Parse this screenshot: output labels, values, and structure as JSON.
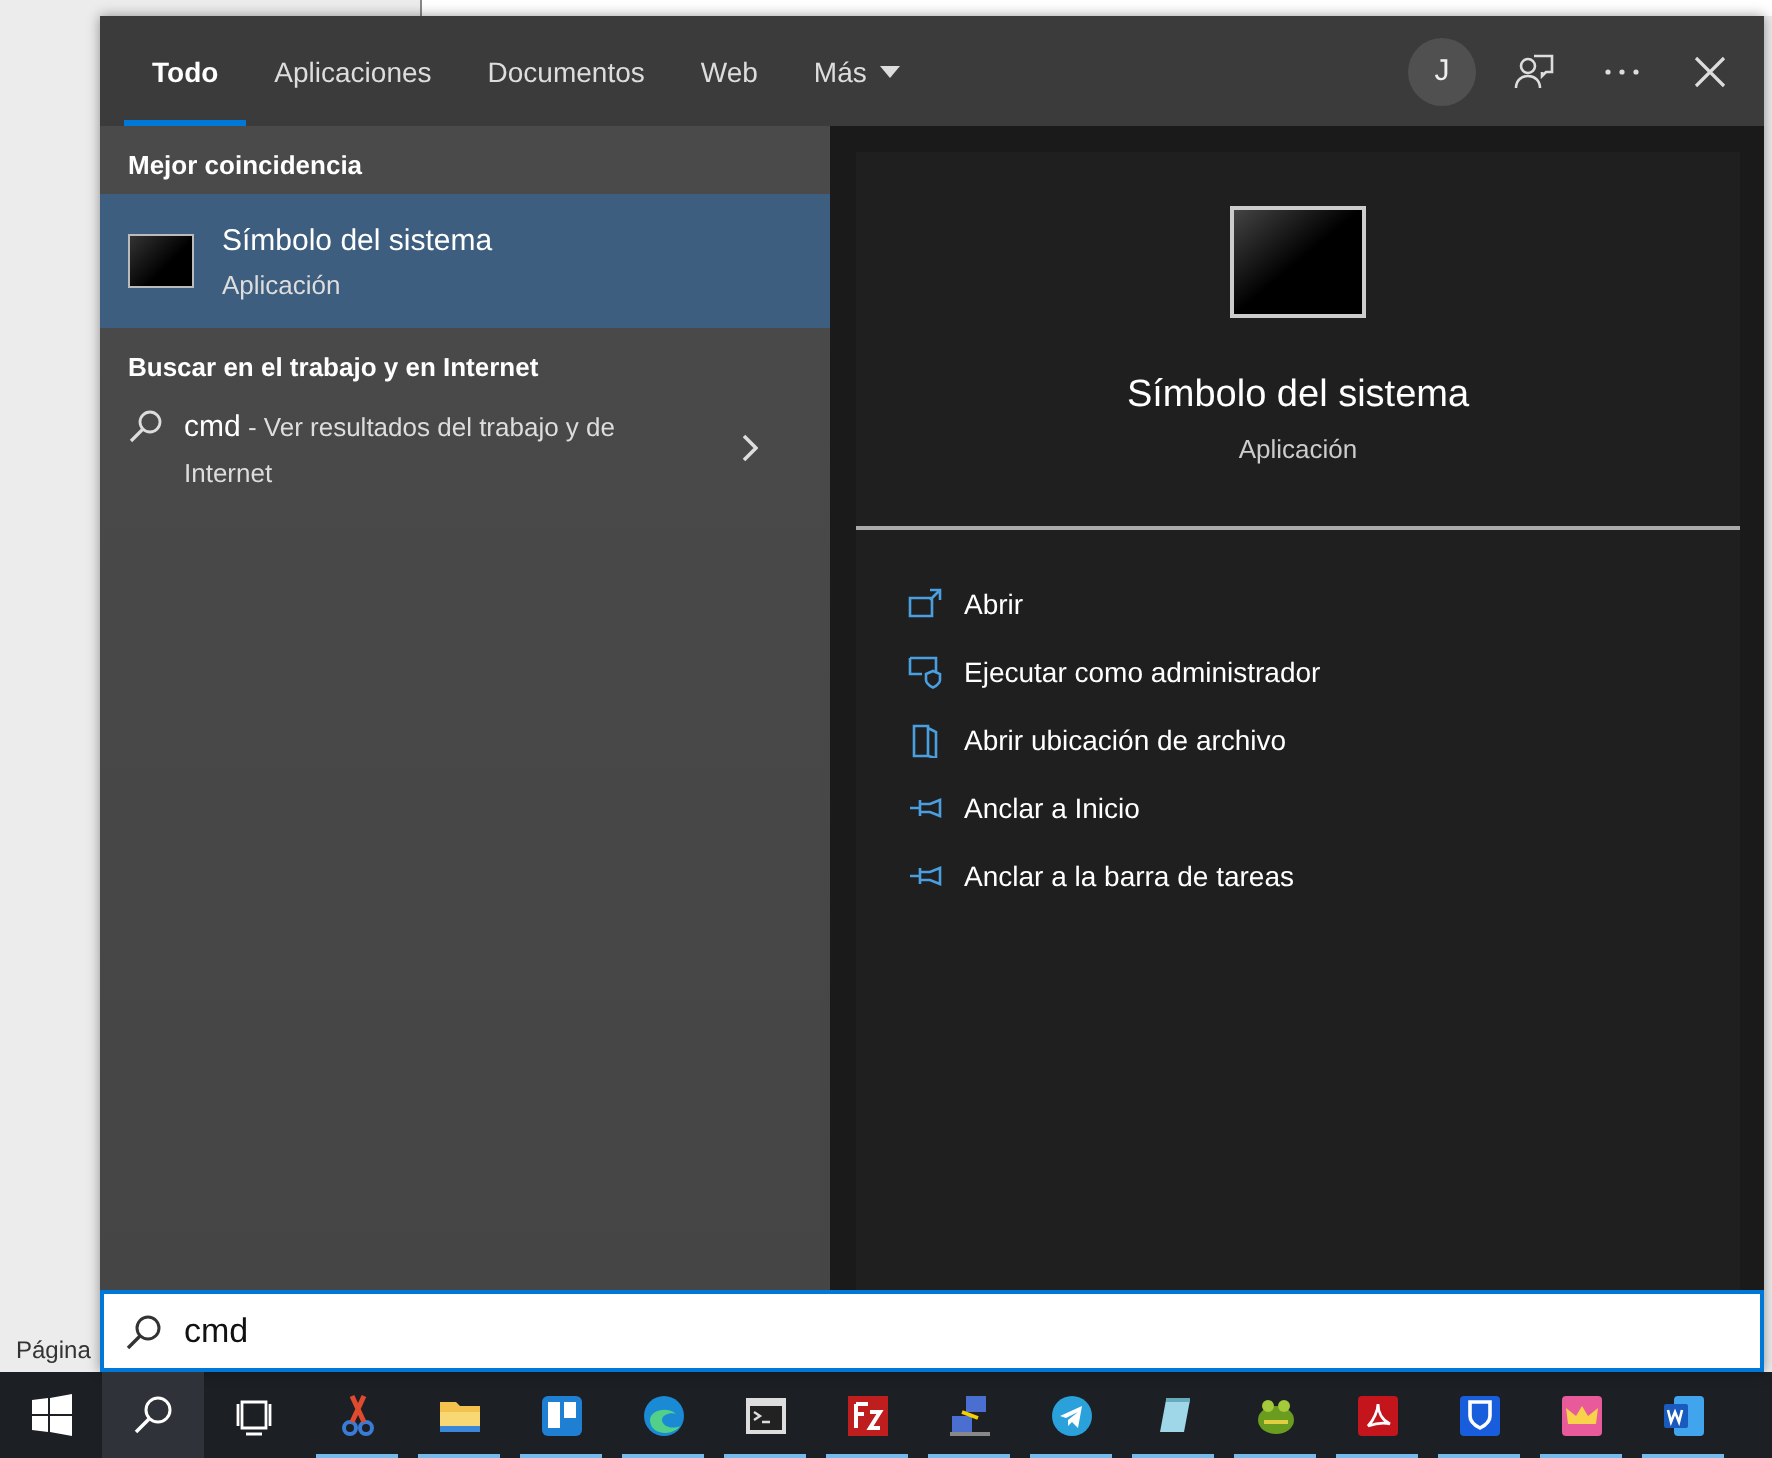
{
  "background_document": {
    "status_text": "Página"
  },
  "search_panel": {
    "tabs": [
      {
        "label": "Todo",
        "kind": "plain",
        "selected": true
      },
      {
        "label": "Aplicaciones",
        "kind": "plain",
        "selected": false
      },
      {
        "label": "Documentos",
        "kind": "plain",
        "selected": false
      },
      {
        "label": "Web",
        "kind": "plain",
        "selected": false
      },
      {
        "label": "Más",
        "kind": "dropdown",
        "selected": false
      }
    ],
    "account_initial": "J",
    "best_match": {
      "heading": "Mejor coincidencia",
      "title": "Símbolo del sistema",
      "subtitle": "Aplicación",
      "selected": true
    },
    "web_section": {
      "heading": "Buscar en el trabajo y en Internet",
      "query": "cmd",
      "description": " - Ver resultados del trabajo y de Internet"
    },
    "preview": {
      "title": "Símbolo del sistema",
      "subtitle": "Aplicación",
      "actions": [
        {
          "kind": "open",
          "label": "Abrir"
        },
        {
          "kind": "admin",
          "label": "Ejecutar como administrador"
        },
        {
          "kind": "location",
          "label": "Abrir ubicación de archivo"
        },
        {
          "kind": "pin",
          "label": "Anclar a Inicio"
        },
        {
          "kind": "pin",
          "label": "Anclar a la barra de tareas"
        }
      ]
    },
    "search_box": {
      "value": "cmd"
    }
  },
  "taskbar": {
    "apps": [
      {
        "kind": "scissors",
        "running": true
      },
      {
        "kind": "folder",
        "running": true
      },
      {
        "kind": "board",
        "running": true
      },
      {
        "kind": "browser",
        "running": true
      },
      {
        "kind": "terminal",
        "running": true
      },
      {
        "kind": "ftp",
        "running": true
      },
      {
        "kind": "network",
        "running": true
      },
      {
        "kind": "plane",
        "running": true
      },
      {
        "kind": "notepad",
        "running": true
      },
      {
        "kind": "frog",
        "running": true
      },
      {
        "kind": "pdf",
        "running": true
      },
      {
        "kind": "shield",
        "running": true
      },
      {
        "kind": "crown",
        "running": true
      },
      {
        "kind": "word",
        "running": true
      }
    ]
  }
}
